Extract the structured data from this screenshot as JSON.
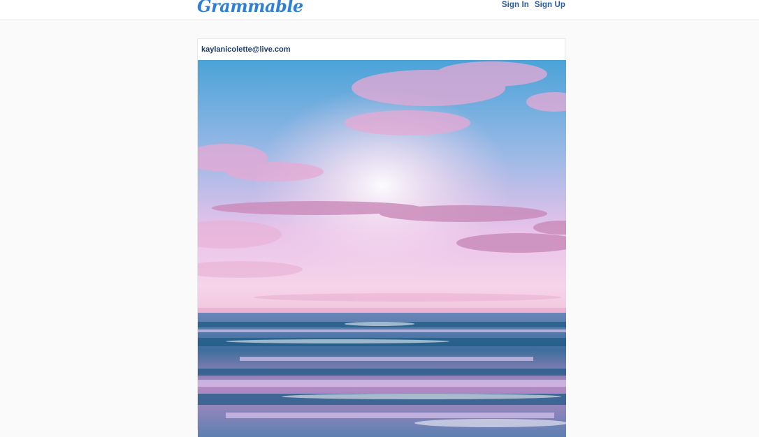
{
  "app": {
    "logo_text": "Grammable"
  },
  "nav": {
    "sign_in": "Sign In",
    "sign_up": "Sign Up"
  },
  "post": {
    "username": "kaylanicolette@live.com",
    "image_semantic": "beach-sunset-photo"
  },
  "colors": {
    "brand": "#2f7fd6",
    "nav_link": "#2b5aa8",
    "username": "#1e3a6b",
    "page_bg": "#fafafa"
  }
}
